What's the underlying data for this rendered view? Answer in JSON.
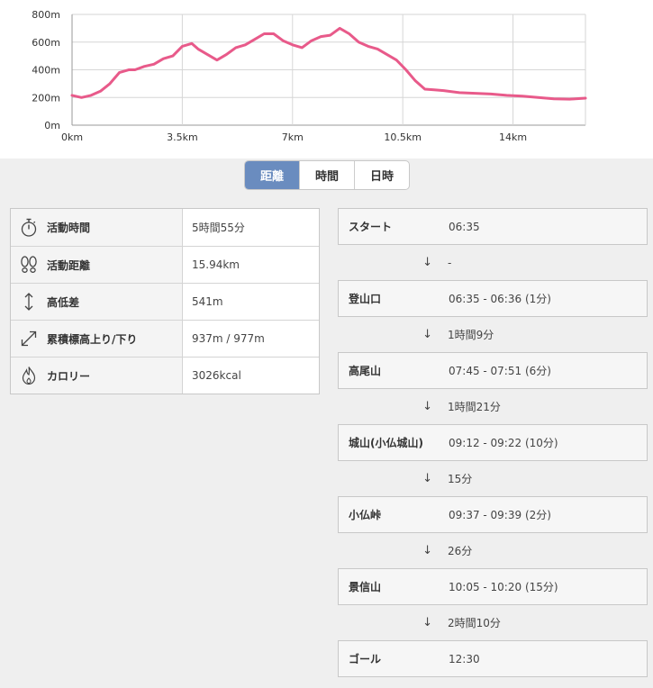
{
  "chart_data": {
    "type": "area",
    "xlabel": "",
    "ylabel": "",
    "x_unit": "km",
    "y_unit": "m",
    "xlim": [
      0,
      16.3
    ],
    "ylim": [
      0,
      800
    ],
    "x_ticks": [
      "0km",
      "3.5km",
      "7km",
      "10.5km",
      "14km"
    ],
    "y_ticks": [
      "0m",
      "200m",
      "400m",
      "600m",
      "800m"
    ],
    "line_color": "#e85a8a",
    "grid": true,
    "x": [
      0,
      0.3,
      0.6,
      0.9,
      1.2,
      1.5,
      1.8,
      2.0,
      2.3,
      2.6,
      2.9,
      3.2,
      3.5,
      3.8,
      4.0,
      4.3,
      4.6,
      4.9,
      5.2,
      5.5,
      5.8,
      6.1,
      6.4,
      6.7,
      7.0,
      7.3,
      7.6,
      7.9,
      8.2,
      8.5,
      8.8,
      9.1,
      9.4,
      9.7,
      10.0,
      10.3,
      10.6,
      10.9,
      11.2,
      11.5,
      11.8,
      12.3,
      12.8,
      13.3,
      13.8,
      14.3,
      14.8,
      15.3,
      15.8,
      16.3
    ],
    "y": [
      215,
      200,
      215,
      245,
      300,
      380,
      400,
      400,
      425,
      440,
      480,
      500,
      570,
      590,
      550,
      510,
      470,
      510,
      560,
      580,
      620,
      660,
      660,
      610,
      580,
      560,
      610,
      640,
      650,
      700,
      660,
      600,
      570,
      550,
      510,
      470,
      400,
      320,
      260,
      255,
      250,
      235,
      230,
      225,
      215,
      210,
      200,
      190,
      188,
      195
    ]
  },
  "tabs": {
    "distance": "距離",
    "time": "時間",
    "datetime": "日時"
  },
  "stats": {
    "active_time": {
      "label": "活動時間",
      "value": "5時間55分"
    },
    "distance": {
      "label": "活動距離",
      "value": "15.94km"
    },
    "elevation_diff": {
      "label": "高低差",
      "value": "541m"
    },
    "ascent_descent": {
      "label": "累積標高上り/下り",
      "value": "937m / 977m"
    },
    "calories": {
      "label": "カロリー",
      "value": "3026kcal"
    }
  },
  "timeline": {
    "arrow": "↓",
    "points": [
      {
        "name": "スタート",
        "time": "06:35"
      },
      {
        "name": "登山口",
        "time": "06:35 - 06:36 (1分)"
      },
      {
        "name": "高尾山",
        "time": "07:45 - 07:51 (6分)"
      },
      {
        "name": "城山(小仏城山)",
        "time": "09:12 - 09:22 (10分)"
      },
      {
        "name": "小仏峠",
        "time": "09:37 - 09:39 (2分)"
      },
      {
        "name": "景信山",
        "time": "10:05 - 10:20 (15分)"
      },
      {
        "name": "ゴール",
        "time": "12:30"
      }
    ],
    "gaps": [
      "-",
      "1時間9分",
      "1時間21分",
      "15分",
      "26分",
      "2時間10分"
    ]
  }
}
